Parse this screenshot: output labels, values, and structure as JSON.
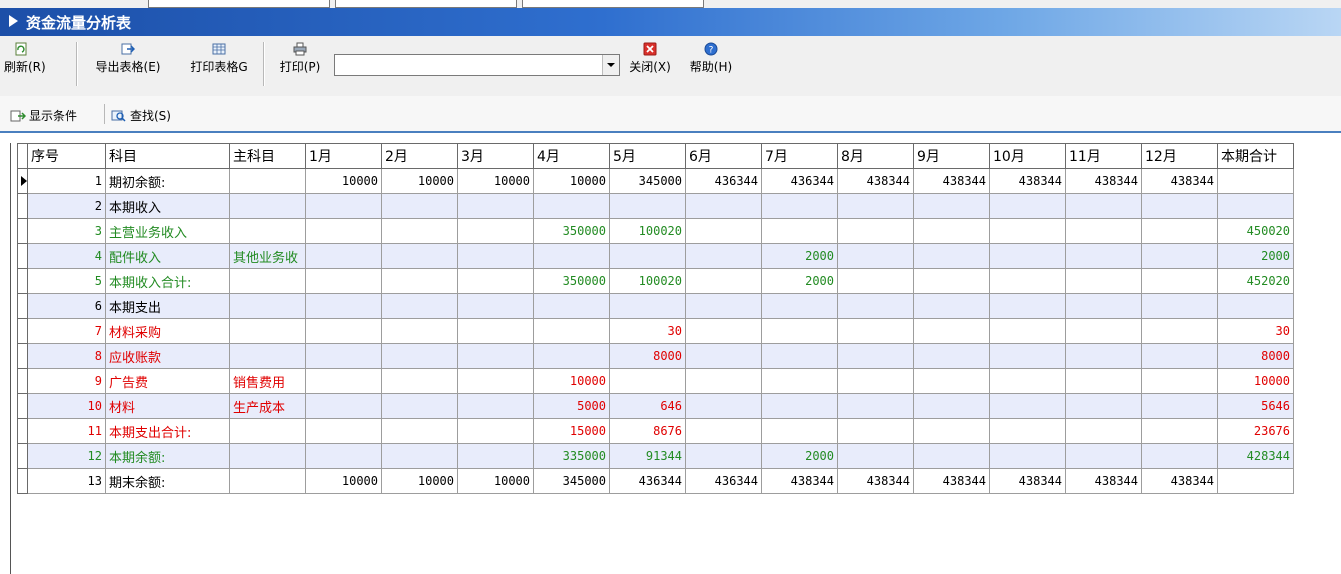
{
  "window": {
    "title": "资金流量分析表"
  },
  "toolbar": {
    "refresh": "刷新(R)",
    "export": "导出表格(E)",
    "print_table": "打印表格G",
    "print": "打印(P)",
    "printer_value": "",
    "close": "关闭(X)",
    "help": "帮助(H)"
  },
  "toolbar2": {
    "show_conditions": "显示条件",
    "find": "查找(S)"
  },
  "grid": {
    "headers": [
      "序号",
      "科目",
      "主科目",
      "1月",
      "2月",
      "3月",
      "4月",
      "5月",
      "6月",
      "7月",
      "8月",
      "9月",
      "10月",
      "11月",
      "12月",
      "本期合计"
    ],
    "rows": [
      {
        "color": "black",
        "cells": [
          "1",
          "期初余额:",
          "",
          "10000",
          "10000",
          "10000",
          "10000",
          "345000",
          "436344",
          "436344",
          "438344",
          "438344",
          "438344",
          "438344",
          "438344",
          ""
        ]
      },
      {
        "color": "black",
        "cells": [
          "2",
          "本期收入",
          "",
          "",
          "",
          "",
          "",
          "",
          "",
          "",
          "",
          "",
          "",
          "",
          "",
          ""
        ]
      },
      {
        "color": "green",
        "cells": [
          "3",
          "主营业务收入",
          "",
          "",
          "",
          "",
          "350000",
          "100020",
          "",
          "",
          "",
          "",
          "",
          "",
          "",
          "450020"
        ]
      },
      {
        "color": "green",
        "cells": [
          "4",
          "配件收入",
          "其他业务收",
          "",
          "",
          "",
          "",
          "",
          "",
          "2000",
          "",
          "",
          "",
          "",
          "",
          "2000"
        ]
      },
      {
        "color": "green",
        "cells": [
          "5",
          "本期收入合计:",
          "",
          "",
          "",
          "",
          "350000",
          "100020",
          "",
          "2000",
          "",
          "",
          "",
          "",
          "",
          "452020"
        ]
      },
      {
        "color": "black",
        "cells": [
          "6",
          "本期支出",
          "",
          "",
          "",
          "",
          "",
          "",
          "",
          "",
          "",
          "",
          "",
          "",
          "",
          ""
        ]
      },
      {
        "color": "red",
        "cells": [
          "7",
          "材料采购",
          "",
          "",
          "",
          "",
          "",
          "30",
          "",
          "",
          "",
          "",
          "",
          "",
          "",
          "30"
        ]
      },
      {
        "color": "red",
        "cells": [
          "8",
          "应收账款",
          "",
          "",
          "",
          "",
          "",
          "8000",
          "",
          "",
          "",
          "",
          "",
          "",
          "",
          "8000"
        ]
      },
      {
        "color": "red",
        "cells": [
          "9",
          "广告费",
          "销售费用",
          "",
          "",
          "",
          "10000",
          "",
          "",
          "",
          "",
          "",
          "",
          "",
          "",
          "10000"
        ]
      },
      {
        "color": "red",
        "cells": [
          "10",
          "材料",
          "生产成本",
          "",
          "",
          "",
          "5000",
          "646",
          "",
          "",
          "",
          "",
          "",
          "",
          "",
          "5646"
        ]
      },
      {
        "color": "red",
        "cells": [
          "11",
          "本期支出合计:",
          "",
          "",
          "",
          "",
          "15000",
          "8676",
          "",
          "",
          "",
          "",
          "",
          "",
          "",
          "23676"
        ]
      },
      {
        "color": "green",
        "cells": [
          "12",
          "本期余额:",
          "",
          "",
          "",
          "",
          "335000",
          "91344",
          "",
          "2000",
          "",
          "",
          "",
          "",
          "",
          "428344"
        ]
      },
      {
        "color": "black",
        "cells": [
          "13",
          "期末余额:",
          "",
          "10000",
          "10000",
          "10000",
          "345000",
          "436344",
          "436344",
          "438344",
          "438344",
          "438344",
          "438344",
          "438344",
          "438344",
          ""
        ]
      }
    ]
  }
}
